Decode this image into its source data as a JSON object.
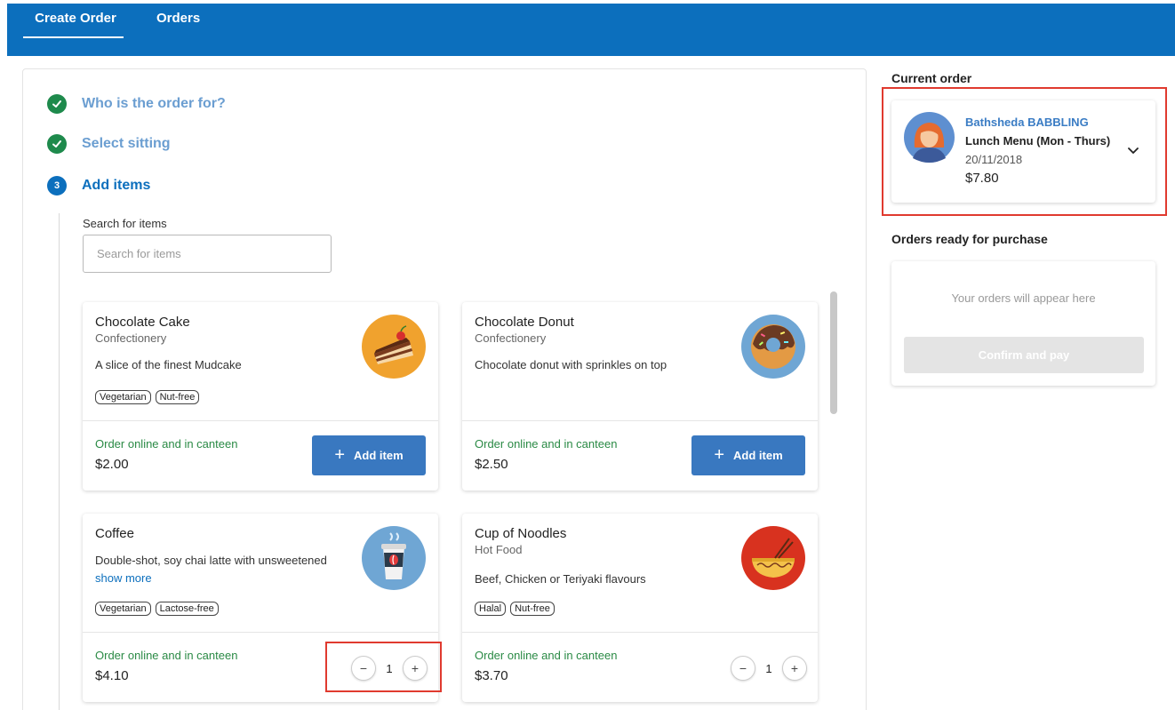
{
  "nav": {
    "tabs": [
      {
        "label": "Create Order",
        "active": true
      },
      {
        "label": "Orders",
        "active": false
      }
    ]
  },
  "steps": [
    {
      "number": "1",
      "label": "Who is the order for?",
      "state": "done"
    },
    {
      "number": "2",
      "label": "Select sitting",
      "state": "done"
    },
    {
      "number": "3",
      "label": "Add items",
      "state": "active"
    }
  ],
  "search": {
    "label": "Search for items",
    "placeholder": "Search for items",
    "value": ""
  },
  "items": [
    {
      "name": "Chocolate Cake",
      "category": "Confectionery",
      "description": "A slice of the finest Mudcake",
      "tags": [
        "Vegetarian",
        "Nut-free"
      ],
      "availability": "Order online and in canteen",
      "price": "$2.00",
      "action": "Add item",
      "icon": "cake-icon"
    },
    {
      "name": "Chocolate Donut",
      "category": "Confectionery",
      "description": "Chocolate donut with sprinkles on top",
      "tags": [],
      "availability": "Order online and in canteen",
      "price": "$2.50",
      "action": "Add item",
      "icon": "donut-icon"
    },
    {
      "name": "Coffee",
      "category": "",
      "description": "Double-shot, soy chai latte with unsweetened",
      "show_more": "show more",
      "tags": [
        "Vegetarian",
        "Lactose-free"
      ],
      "availability": "Order online and in canteen",
      "price": "$4.10",
      "quantity": "1",
      "icon": "coffee-cup-icon"
    },
    {
      "name": "Cup of Noodles",
      "category": "Hot Food",
      "description": "Beef, Chicken or Teriyaki flavours",
      "tags": [
        "Halal",
        "Nut-free"
      ],
      "availability": "Order online and in canteen",
      "price": "$3.70",
      "quantity": "1",
      "icon": "noodle-bowl-icon"
    }
  ],
  "quantity_controls": {
    "minus": "−",
    "plus": "+"
  },
  "add_plus": "+",
  "sidebar": {
    "current_order_title": "Current order",
    "current_order": {
      "name": "Bathsheda BABBLING",
      "menu": "Lunch Menu (Mon - Thurs)",
      "date": "20/11/2018",
      "total": "$7.80"
    },
    "ready_title": "Orders ready for purchase",
    "ready_empty": "Your orders will appear here",
    "confirm_label": "Confirm and pay"
  },
  "colors": {
    "primary": "#0c6fbd",
    "success": "#1e8a4c",
    "availability": "#2a8a45",
    "highlight": "#e03a2f"
  }
}
